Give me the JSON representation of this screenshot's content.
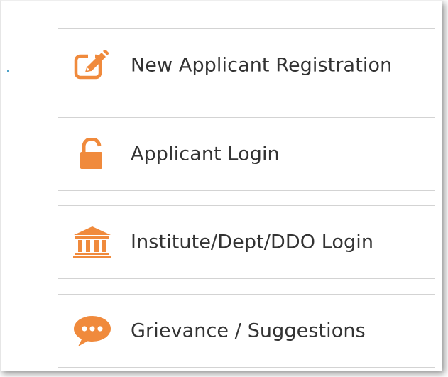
{
  "colors": {
    "accent": "#f08a3c",
    "text": "#333333",
    "border": "#d3d3d3"
  },
  "menu": {
    "items": [
      {
        "label": "New Applicant Registration",
        "icon": "edit-icon"
      },
      {
        "label": "Applicant Login",
        "icon": "unlock-icon"
      },
      {
        "label": "Institute/Dept/DDO Login",
        "icon": "institution-icon"
      },
      {
        "label": "Grievance / Suggestions",
        "icon": "chat-bubble-icon"
      }
    ]
  }
}
